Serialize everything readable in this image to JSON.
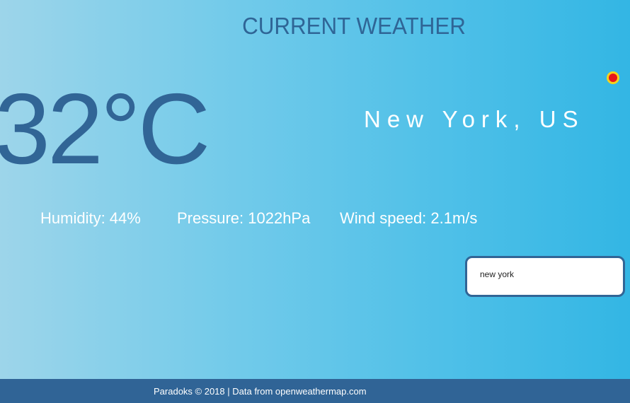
{
  "header": {
    "title": "CURRENT WEATHER"
  },
  "weather": {
    "temperature": "32°C",
    "location": "New York, US",
    "humidity": "Humidity: 44%",
    "pressure": "Pressure: 1022hPa",
    "wind_speed": "Wind speed: 2.1m/s"
  },
  "search": {
    "value": "new york"
  },
  "footer": {
    "text": "Paradoks © 2018 | Data from openweathermap.com"
  },
  "colors": {
    "title": "#2f6596",
    "temperature": "#316596",
    "footer_bg": "#306496",
    "location_dot": "#e8161a"
  },
  "icons": {
    "location": "location-dot-icon"
  }
}
